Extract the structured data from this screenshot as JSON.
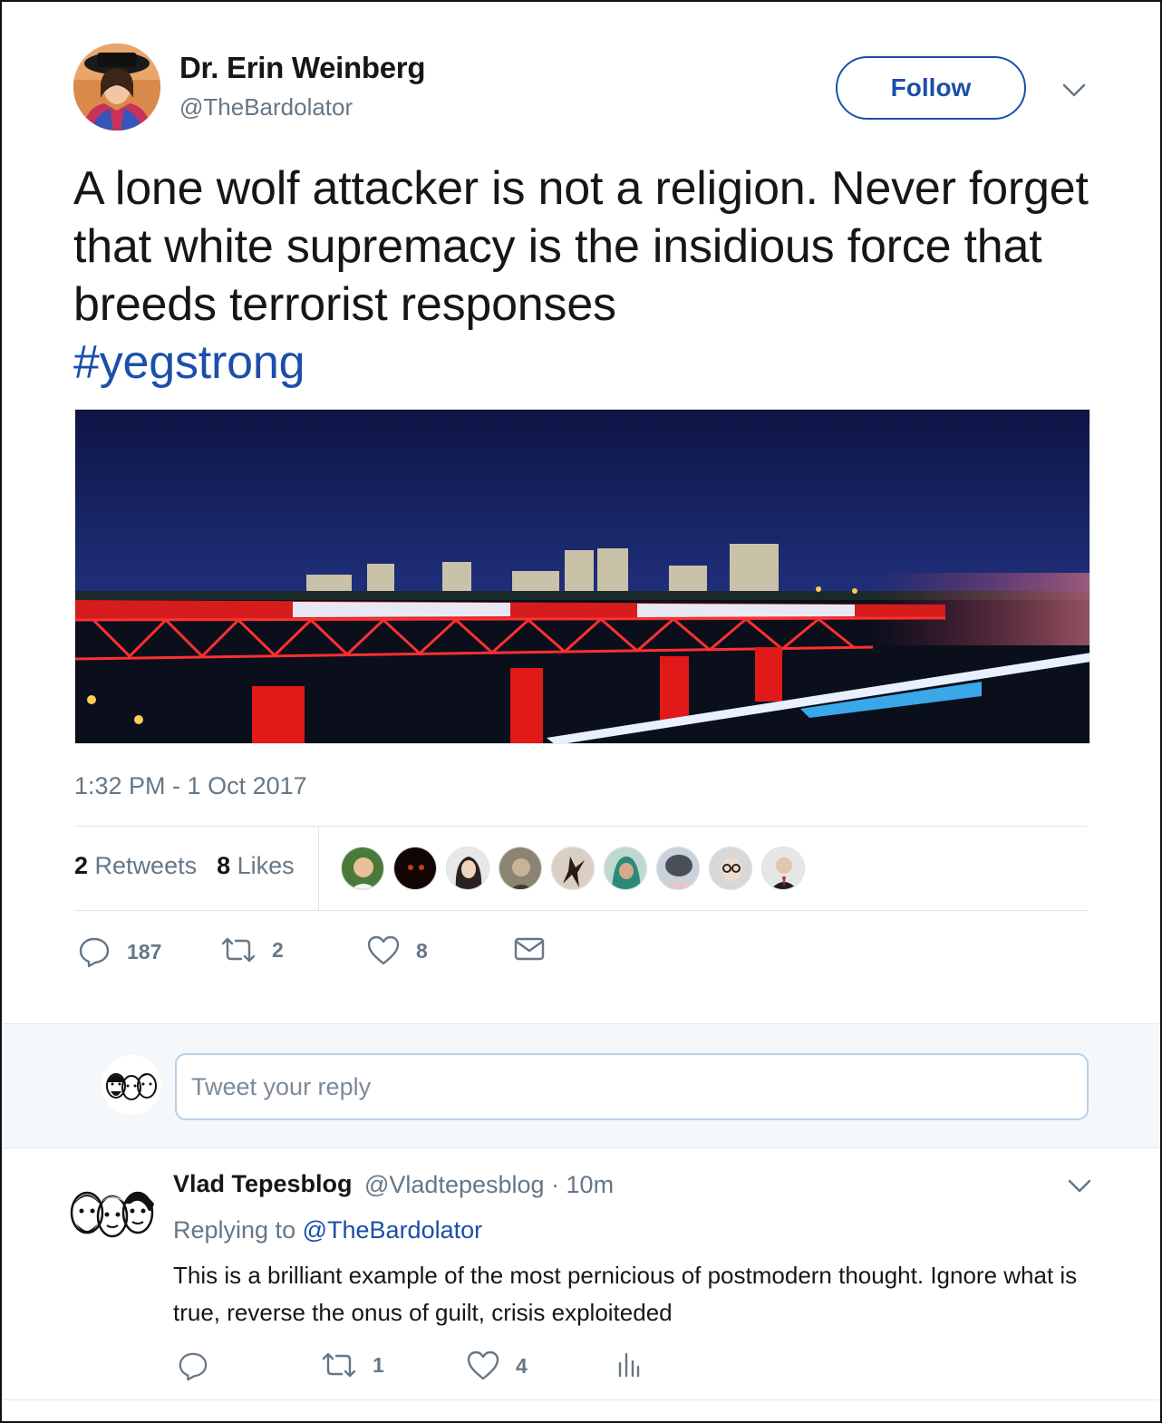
{
  "tweet": {
    "author_name": "Dr. Erin Weinberg",
    "author_handle": "@TheBardolator",
    "follow_label": "Follow",
    "text": "A lone wolf attacker is not a religion. Never forget that white supremacy is the insidious force that breeds terrorist responses",
    "hashtag": "#yegstrong",
    "timestamp": "1:32 PM - 1 Oct 2017",
    "retweets_count": "2",
    "retweets_label": "Retweets",
    "likes_count": "8",
    "likes_label": "Likes",
    "actions": {
      "reply_count": "187",
      "retweet_count": "2",
      "like_count": "8"
    }
  },
  "reply_composer": {
    "placeholder": "Tweet your reply"
  },
  "reply": {
    "author_name": "Vlad Tepesblog",
    "author_handle": "@Vladtepesblog · 10m",
    "replying_prefix": "Replying to",
    "replying_to": "@TheBardolator",
    "text": "This is a brilliant example of the most pernicious of postmodern thought. Ignore what is true, reverse the onus of guilt, crisis exploiteded",
    "actions": {
      "reply_count": "",
      "retweet_count": "1",
      "like_count": "4"
    }
  },
  "colors": {
    "link": "#1b4fa8",
    "muted": "#657786",
    "text": "#14171a"
  }
}
